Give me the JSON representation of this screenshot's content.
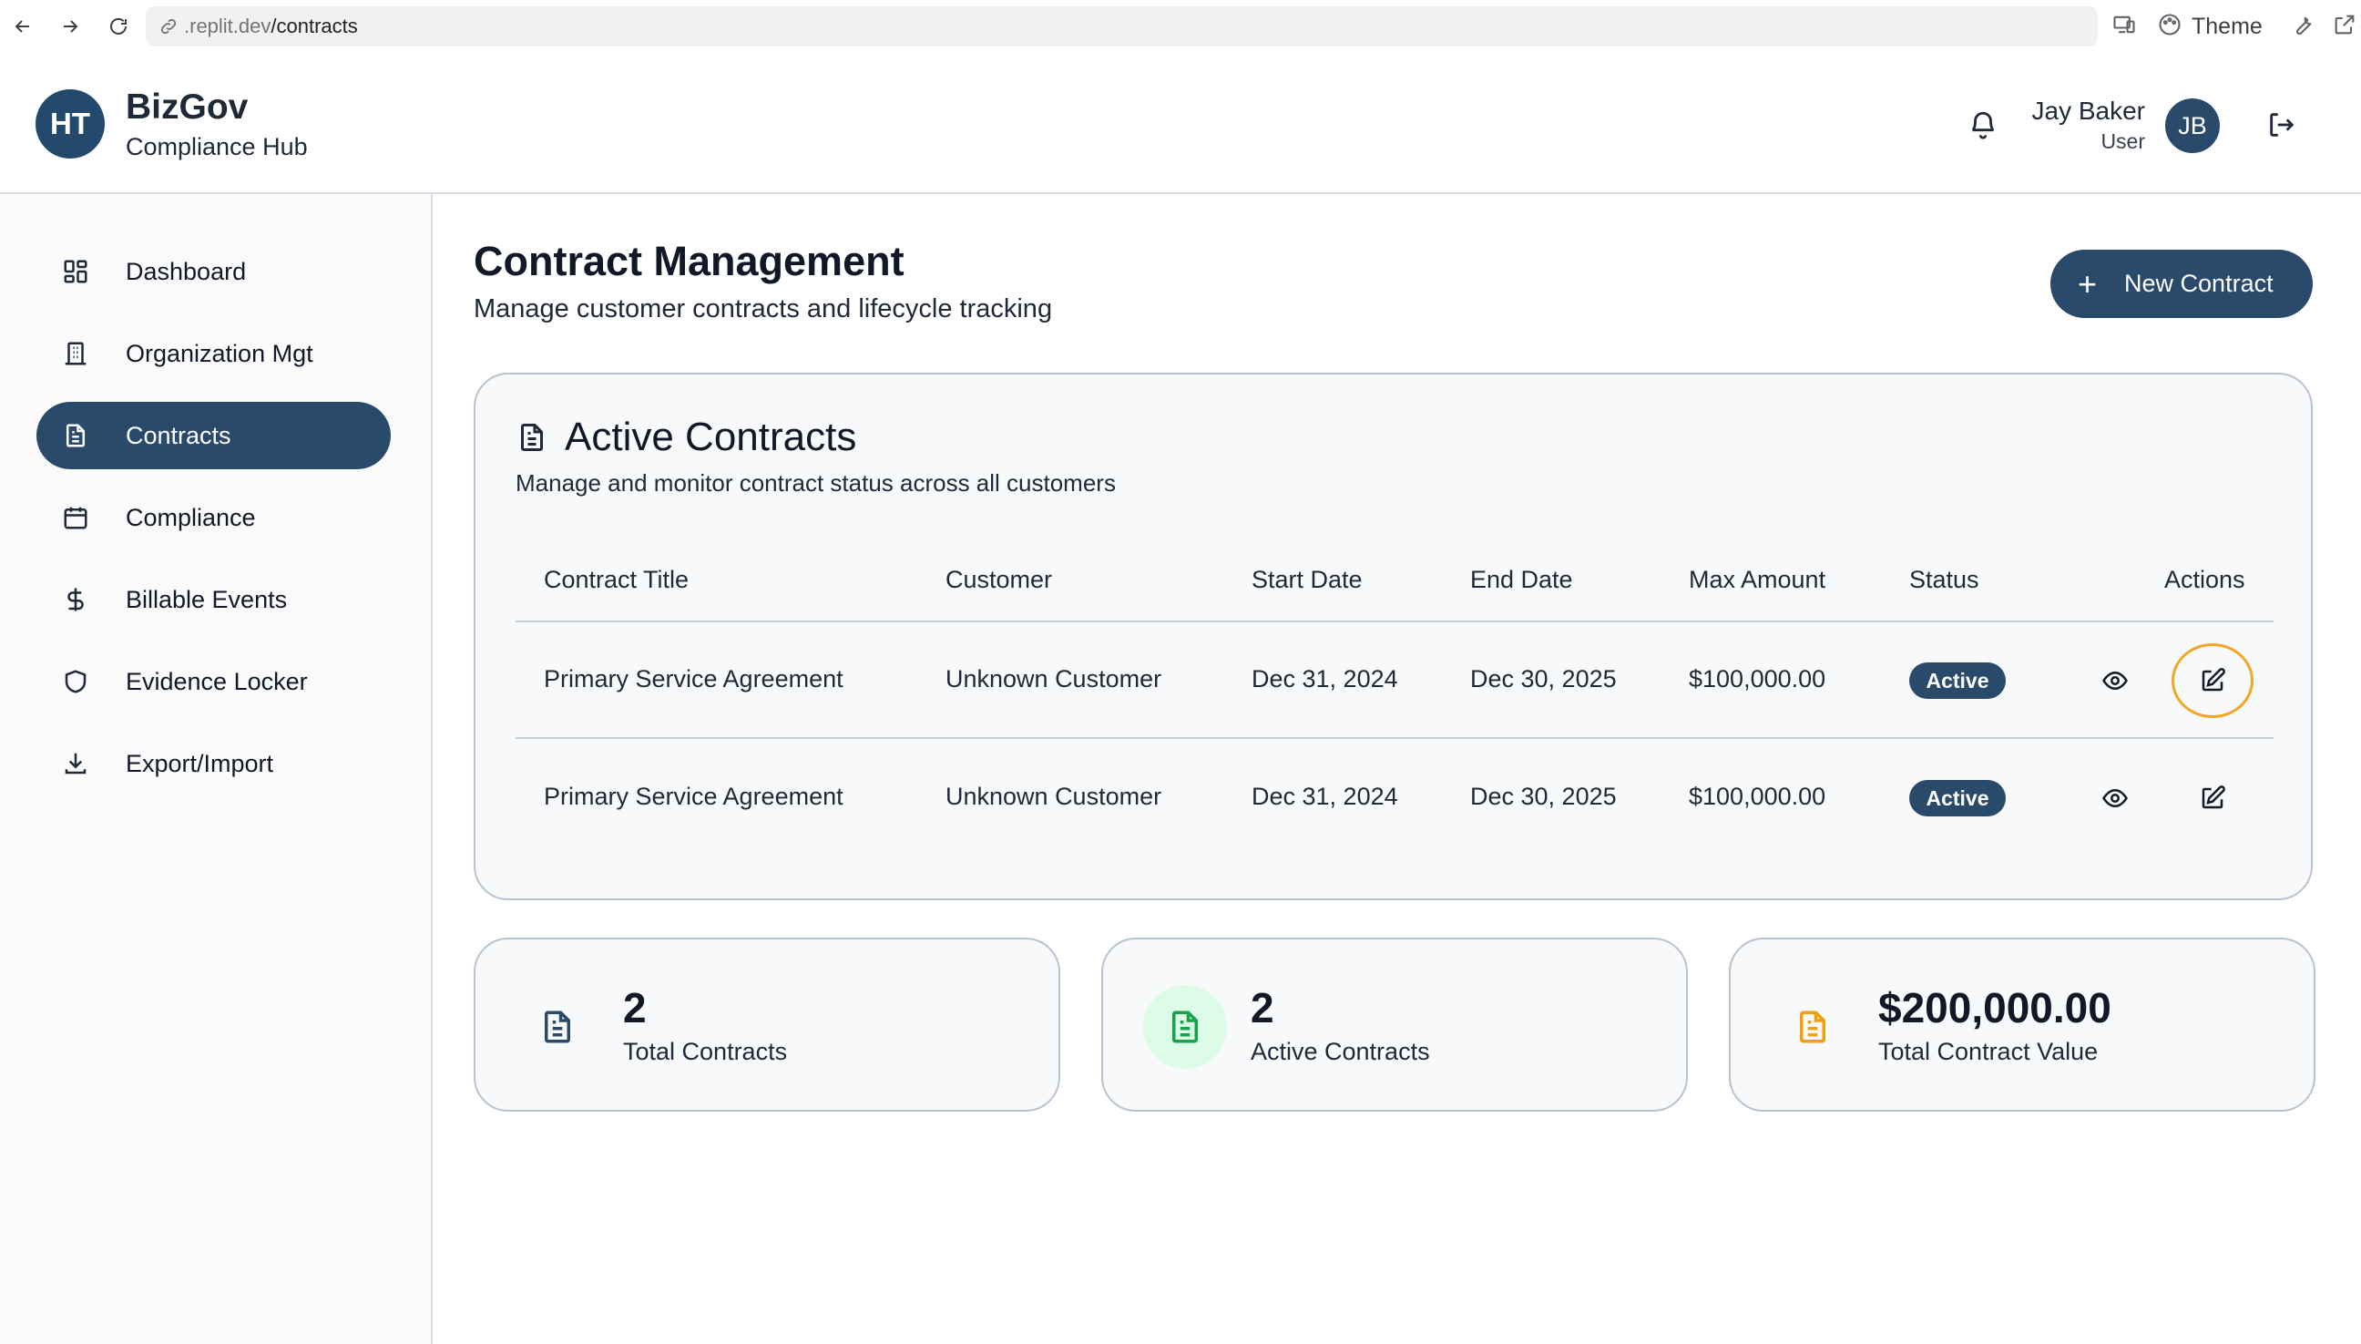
{
  "browser": {
    "url_host": ".replit.dev",
    "url_path": "/contracts",
    "theme_label": "Theme"
  },
  "header": {
    "logo_initials": "HT",
    "brand_title": "BizGov",
    "brand_subtitle": "Compliance Hub",
    "user_name": "Jay Baker",
    "user_role": "User",
    "user_initials": "JB"
  },
  "sidebar": {
    "items": [
      {
        "label": "Dashboard",
        "icon": "dashboard-icon"
      },
      {
        "label": "Organization Mgt",
        "icon": "building-icon"
      },
      {
        "label": "Contracts",
        "icon": "document-icon",
        "active": true
      },
      {
        "label": "Compliance",
        "icon": "calendar-icon"
      },
      {
        "label": "Billable Events",
        "icon": "dollar-icon"
      },
      {
        "label": "Evidence Locker",
        "icon": "shield-icon"
      },
      {
        "label": "Export/Import",
        "icon": "download-icon"
      }
    ]
  },
  "page": {
    "title": "Contract Management",
    "subtitle": "Manage customer contracts and lifecycle tracking",
    "new_button_label": "New Contract"
  },
  "contracts_card": {
    "title": "Active Contracts",
    "subtitle": "Manage and monitor contract status across all customers",
    "columns": [
      "Contract Title",
      "Customer",
      "Start Date",
      "End Date",
      "Max Amount",
      "Status",
      "Actions"
    ],
    "rows": [
      {
        "title": "Primary Service Agreement",
        "customer": "Unknown Customer",
        "start": "Dec 31, 2024",
        "end": "Dec 30, 2025",
        "amount": "$100,000.00",
        "status": "Active"
      },
      {
        "title": "Primary Service Agreement",
        "customer": "Unknown Customer",
        "start": "Dec 31, 2024",
        "end": "Dec 30, 2025",
        "amount": "$100,000.00",
        "status": "Active"
      }
    ]
  },
  "stats": [
    {
      "value": "2",
      "label": "Total Contracts",
      "color": "#2a4a6b"
    },
    {
      "value": "2",
      "label": "Active Contracts",
      "color": "#16a34a"
    },
    {
      "value": "$200,000.00",
      "label": "Total Contract Value",
      "color": "#f59e0b"
    }
  ],
  "colors": {
    "primary": "#2a4a6b",
    "focus": "#f4a623",
    "success": "#16a34a",
    "warning": "#f59e0b"
  }
}
